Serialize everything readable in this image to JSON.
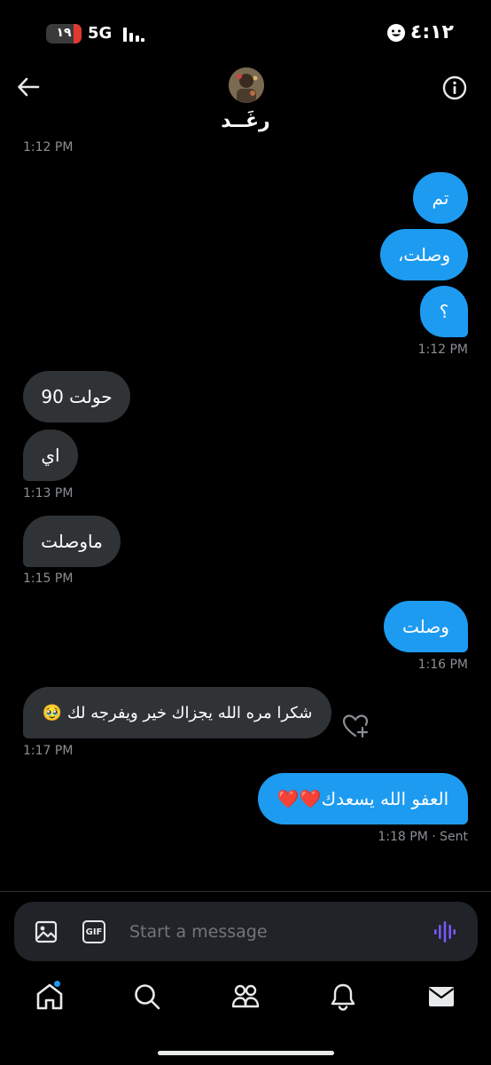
{
  "status_bar": {
    "battery": "١٩",
    "network": "5G",
    "time": "٤:١٢"
  },
  "header": {
    "contact_name": "رغَــد"
  },
  "messages": [
    {
      "text": "تم",
      "direction": "out"
    },
    {
      "text": "وصلت،",
      "direction": "out"
    },
    {
      "text": "؟",
      "direction": "out"
    },
    {
      "text": "حولت 90",
      "direction": "in"
    },
    {
      "text": "اي",
      "direction": "in"
    },
    {
      "text": "ماوصلت",
      "direction": "in"
    },
    {
      "text": "وصلت",
      "direction": "out"
    },
    {
      "text": "شكرا مره الله يجزاك خير ويفرجه لك 🥹",
      "direction": "in"
    },
    {
      "text": "العفو الله يسعدك❤️❤️",
      "direction": "out"
    }
  ],
  "timestamps": [
    "1:12 PM",
    "1:12 PM",
    "1:13 PM",
    "1:15 PM",
    "1:16 PM",
    "1:17 PM",
    "1:18 PM · Sent"
  ],
  "composer": {
    "placeholder": "Start a message",
    "gif_label": "GIF"
  },
  "colors": {
    "accent": "#1d9bf0",
    "incoming_bubble": "#2f3336",
    "background": "#000000",
    "voice_icon": "#7856ff"
  },
  "nav": {
    "items": [
      "home-icon",
      "search-icon",
      "communities-icon",
      "notifications-icon",
      "messages-icon"
    ]
  }
}
